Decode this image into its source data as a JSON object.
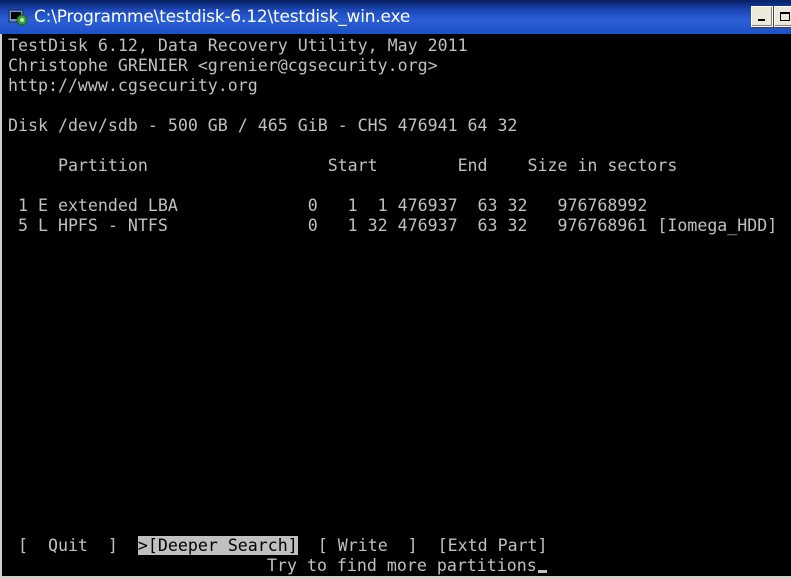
{
  "window": {
    "title": "C:\\Programme\\testdisk-6.12\\testdisk_win.exe"
  },
  "console": {
    "header": [
      "TestDisk 6.12, Data Recovery Utility, May 2011",
      "Christophe GRENIER <grenier@cgsecurity.org>",
      "http://www.cgsecurity.org"
    ],
    "disk_info": "Disk /dev/sdb - 500 GB / 465 GiB - CHS 476941 64 32",
    "columns": "     Partition                  Start        End    Size in sectors",
    "partitions": [
      " 1 E extended LBA             0   1  1 476937  63 32   976768992",
      " 5 L HPFS - NTFS              0   1 32 476937  63 32   976768961 [Iomega_HDD]"
    ],
    "menu": {
      "quit": "  Quit  ",
      "deeper_search": ">[Deeper Search]",
      "write": "[ Write  ]",
      "extd_part": "[Extd Part]"
    },
    "hint": "Try to find more partitions"
  }
}
